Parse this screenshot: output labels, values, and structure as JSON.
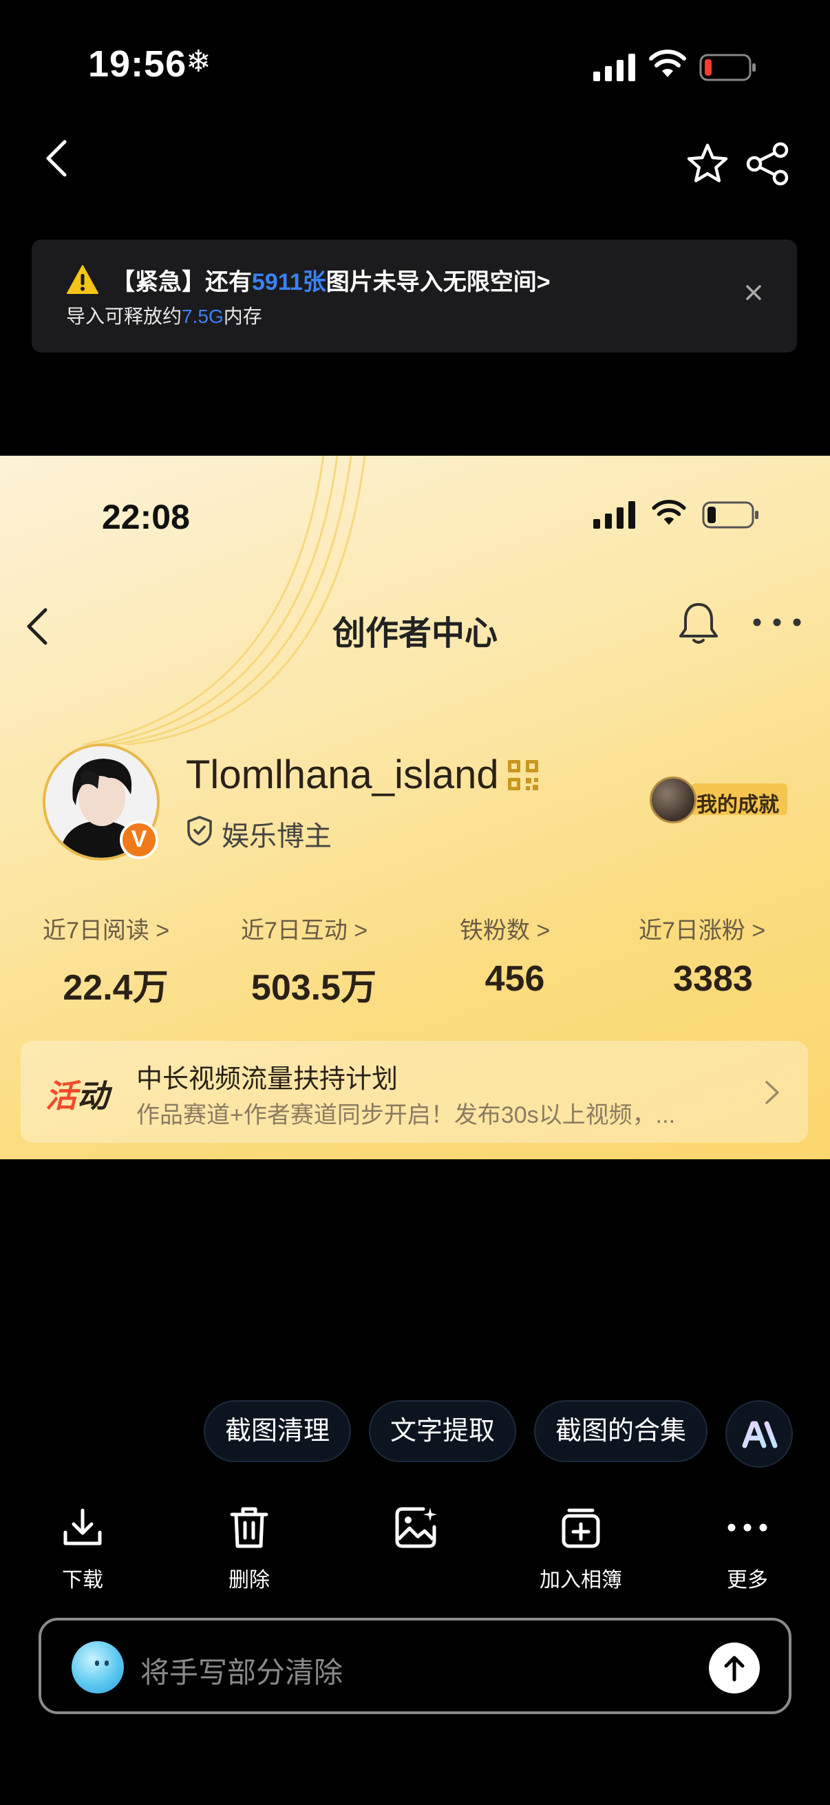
{
  "status_bar": {
    "time": "19:56",
    "snow_glyph": "❄"
  },
  "banner": {
    "line1_pre": "【紧急】还有",
    "line1_count": "5911张",
    "line1_post": "图片未导入无限空间>",
    "line2_pre": "导入可释放约",
    "line2_size": "7.5G",
    "line2_post": "内存",
    "icon": "warning-icon"
  },
  "screenshot": {
    "time": "22:08",
    "title": "创作者中心",
    "profile": {
      "username": "Tlomlhana_island",
      "badge": "V",
      "role": "娱乐博主",
      "achievement": "我的成就"
    },
    "stats": [
      {
        "label": "近7日阅读 >",
        "value": "22.4万"
      },
      {
        "label": "近7日互动 >",
        "value": "503.5万"
      },
      {
        "label": "铁粉数 >",
        "value": "456"
      },
      {
        "label": "近7日涨粉 >",
        "value": "3383"
      }
    ],
    "activity": {
      "tag_a": "活",
      "tag_b": "动",
      "title": "中长视频流量扶持计划",
      "subtitle": "作品赛道+作者赛道同步开启！发布30s以上视频，..."
    }
  },
  "chips": [
    "截图清理",
    "文字提取",
    "截图的合集"
  ],
  "ai_chip_label": "AI",
  "toolbar": [
    {
      "label": "下载",
      "icon": "download-icon"
    },
    {
      "label": "删除",
      "icon": "trash-icon"
    },
    {
      "label": "",
      "icon": "image-edit-icon"
    },
    {
      "label": "加入相簿",
      "icon": "add-album-icon"
    },
    {
      "label": "更多",
      "icon": "more-icon"
    }
  ],
  "input": {
    "placeholder": "将手写部分清除"
  },
  "colors": {
    "accent_blue": "#3b82f6",
    "activity_red": "#ef4b2b",
    "badge_orange": "#f07a1a"
  }
}
